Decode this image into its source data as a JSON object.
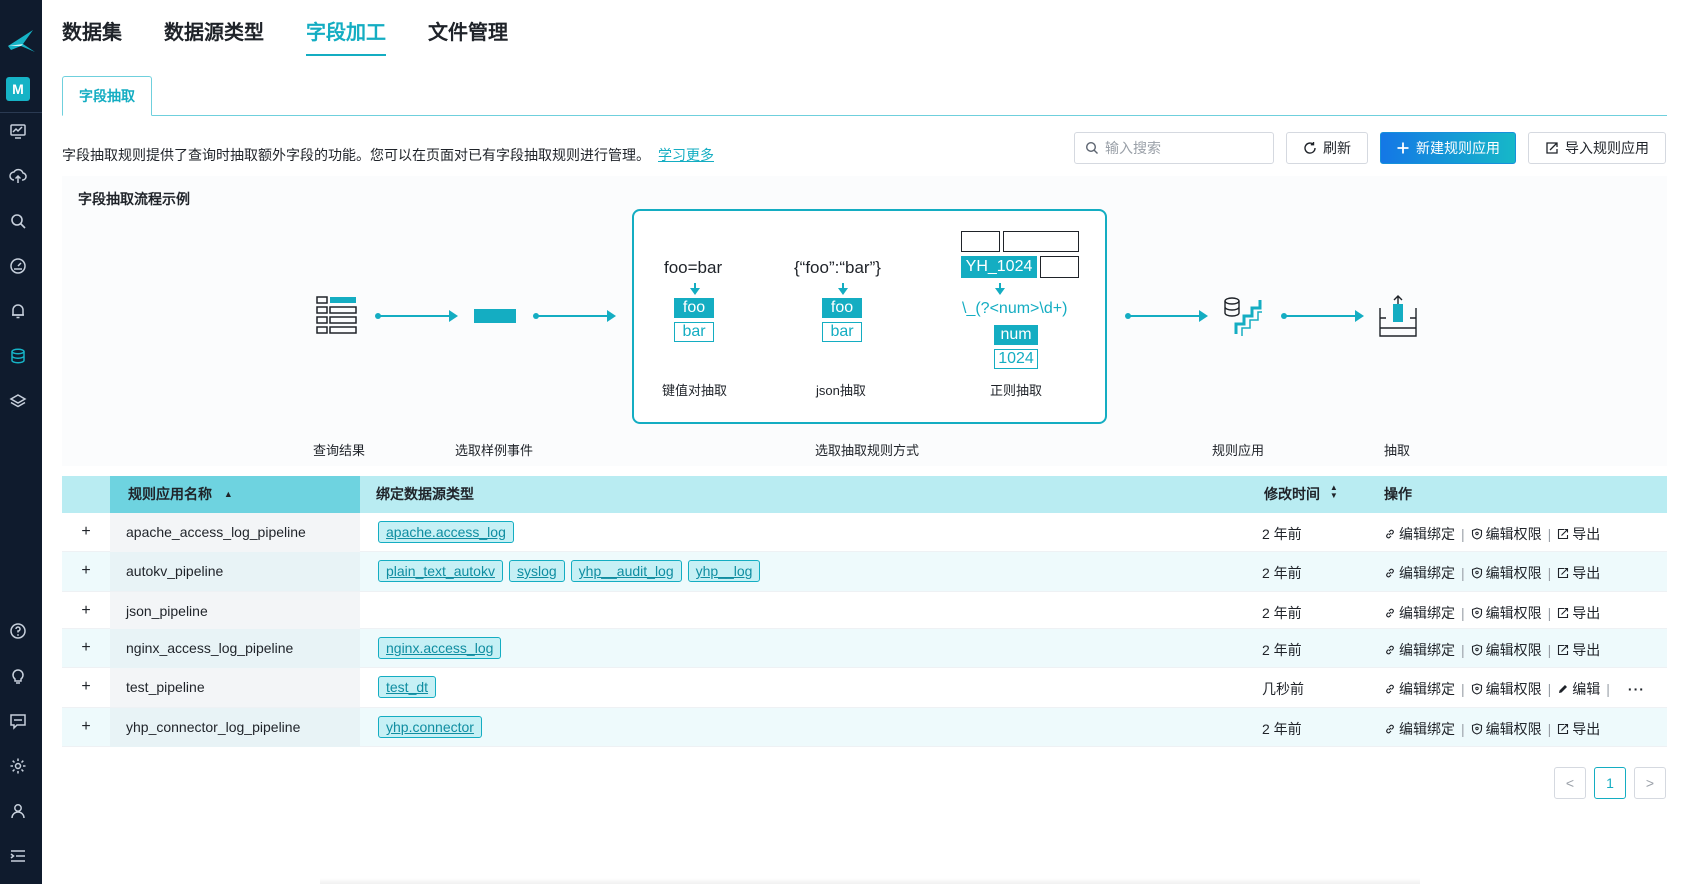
{
  "sidebar": {
    "avatar_letter": "M",
    "icons": [
      "dashboard-icon",
      "upload-icon",
      "search-icon",
      "gauge-icon",
      "bell-icon",
      "database-icon",
      "layers-icon",
      "help-icon",
      "bulb-icon",
      "chat-icon",
      "settings-icon",
      "user-icon",
      "collapse-icon"
    ]
  },
  "topnav": {
    "items": [
      "数据集",
      "数据源类型",
      "字段加工",
      "文件管理"
    ],
    "active": "字段加工"
  },
  "subtab": {
    "label": "字段抽取"
  },
  "description": {
    "text": "字段抽取规则提供了查询时抽取额外字段的功能。您可以在页面对已有字段抽取规则进行管理。",
    "link": "学习更多"
  },
  "toolbar": {
    "search_placeholder": "输入搜索",
    "refresh": "刷新",
    "new_rule": "新建规则应用",
    "import_rule": "导入规则应用"
  },
  "diagram": {
    "title": "字段抽取流程示例",
    "kv": {
      "input": "foo=bar",
      "key": "foo",
      "value": "bar",
      "caption": "键值对抽取"
    },
    "json": {
      "input": "{“foo”:“bar”}",
      "key": "foo",
      "value": "bar",
      "caption": "json抽取"
    },
    "regex": {
      "input": "YH_1024",
      "pattern": "\\_(?<num>\\d+)",
      "key": "num",
      "value": "1024",
      "caption": "正则抽取"
    },
    "stages": [
      "查询结果",
      "选取样例事件",
      "选取抽取规则方式",
      "规则应用",
      "抽取"
    ]
  },
  "table": {
    "headers": {
      "name": "规则应用名称",
      "datasource": "绑定数据源类型",
      "time": "修改时间",
      "ops": "操作"
    },
    "op_labels": {
      "bind": "编辑绑定",
      "perm": "编辑权限",
      "export": "导出",
      "edit": "编辑",
      "more": "···"
    },
    "rows": [
      {
        "name": "apache_access_log_pipeline",
        "tags": [
          "apache.access_log"
        ],
        "time": "2 年前"
      },
      {
        "name": "autokv_pipeline",
        "tags": [
          "plain_text_autokv",
          "syslog",
          "yhp__audit_log",
          "yhp__log"
        ],
        "time": "2 年前"
      },
      {
        "name": "json_pipeline",
        "tags": [],
        "time": "2 年前"
      },
      {
        "name": "nginx_access_log_pipeline",
        "tags": [
          "nginx.access_log"
        ],
        "time": "2 年前"
      },
      {
        "name": "test_pipeline",
        "tags": [
          "test_dt"
        ],
        "time": "几秒前"
      },
      {
        "name": "yhp_connector_log_pipeline",
        "tags": [
          "yhp.connector"
        ],
        "time": "2 年前"
      }
    ]
  },
  "pagination": {
    "prev": "<",
    "current": "1",
    "next": ">"
  },
  "colors": {
    "accent": "#14adc2",
    "sidebar": "#0f1b2d",
    "header": "#b9ecf2"
  }
}
